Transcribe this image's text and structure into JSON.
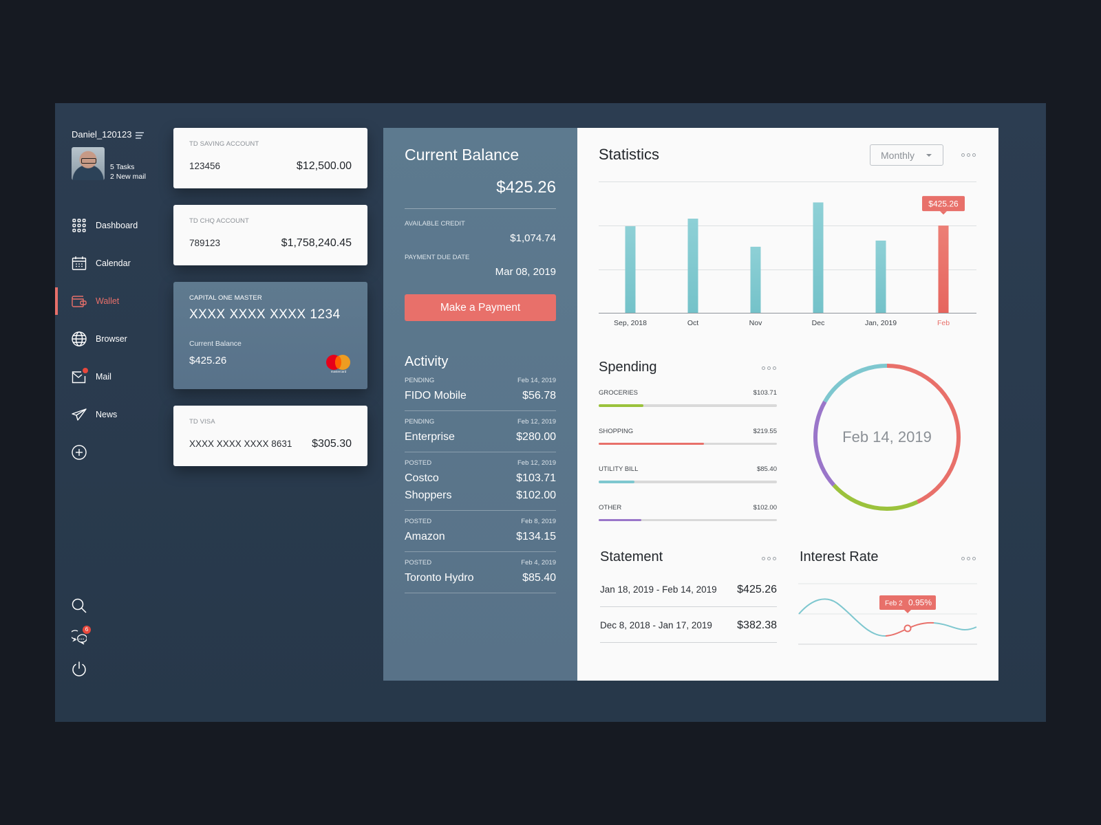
{
  "user": {
    "name": "Daniel_120123",
    "tasks": "5 Tasks",
    "mail": "2 New mail"
  },
  "nav": [
    {
      "label": "Dashboard",
      "icon": "grid-icon",
      "active": false
    },
    {
      "label": "Calendar",
      "icon": "calendar-icon",
      "active": false
    },
    {
      "label": "Wallet",
      "icon": "wallet-icon",
      "active": true
    },
    {
      "label": "Browser",
      "icon": "globe-icon",
      "active": false
    },
    {
      "label": "Mail",
      "icon": "mail-icon",
      "active": false,
      "badge": true
    },
    {
      "label": "News",
      "icon": "paper-plane-icon",
      "active": false
    }
  ],
  "bottom_icons": {
    "chat_badge": "6"
  },
  "accounts": [
    {
      "title": "TD SAVING ACCOUNT",
      "number": "123456",
      "balance": "$12,500.00"
    },
    {
      "title": "TD CHQ ACCOUNT",
      "number": "789123",
      "balance": "$1,758,240.45"
    },
    {
      "title": "CAPITAL ONE MASTER",
      "number": "XXXX XXXX XXXX 1234",
      "balance_label": "Current Balance",
      "balance": "$425.26",
      "brand": "mastercard"
    },
    {
      "title": "TD VISA",
      "number": "XXXX XXXX XXXX 8631",
      "balance": "$305.30"
    }
  ],
  "balance_panel": {
    "title": "Current Balance",
    "amount": "$425.26",
    "available_credit_label": "AVAILABLE CREDIT",
    "available_credit": "$1,074.74",
    "due_label": "PAYMENT DUE DATE",
    "due_date": "Mar 08, 2019",
    "pay_button": "Make a Payment",
    "activity_title": "Activity",
    "activity": [
      {
        "status": "PENDING",
        "date": "Feb 14, 2019",
        "items": [
          {
            "name": "FIDO Mobile",
            "amount": "$56.78"
          }
        ]
      },
      {
        "status": "PENDING",
        "date": "Feb 12, 2019",
        "items": [
          {
            "name": "Enterprise",
            "amount": "$280.00"
          }
        ]
      },
      {
        "status": "POSTED",
        "date": "Feb 12, 2019",
        "items": [
          {
            "name": "Costco",
            "amount": "$103.71"
          },
          {
            "name": "Shoppers",
            "amount": "$102.00"
          }
        ]
      },
      {
        "status": "POSTED",
        "date": "Feb 8, 2019",
        "items": [
          {
            "name": "Amazon",
            "amount": "$134.15"
          }
        ]
      },
      {
        "status": "POSTED",
        "date": "Feb 4, 2019",
        "items": [
          {
            "name": "Toronto Hydro",
            "amount": "$85.40"
          }
        ]
      }
    ]
  },
  "statistics": {
    "title": "Statistics",
    "period": "Monthly"
  },
  "colors": {
    "accent": "#e8706a",
    "teal": "#7ec7cf",
    "green": "#9bc23c",
    "purple": "#9a76c9"
  },
  "chart_data": {
    "type": "bar",
    "title": "Statistics",
    "categories": [
      "Sep, 2018",
      "Oct",
      "Nov",
      "Dec",
      "Jan, 2019",
      "Feb"
    ],
    "values": [
      422,
      459,
      322,
      538,
      352,
      425.26
    ],
    "highlight_index": 5,
    "highlight_label": "$425.26",
    "ylim": [
      0,
      640
    ],
    "grid": true,
    "xlabel": "",
    "ylabel": ""
  },
  "spending": {
    "title": "Spending",
    "items": [
      {
        "label": "GROCERIES",
        "amount": "$103.71",
        "value": 103.71,
        "progress": 0.25,
        "color": "#9bc23c"
      },
      {
        "label": "SHOPPING",
        "amount": "$219.55",
        "value": 219.55,
        "progress": 0.59,
        "color": "#e8706a"
      },
      {
        "label": "UTILITY BILL",
        "amount": "$85.40",
        "value": 85.4,
        "progress": 0.2,
        "color": "#7ec7cf"
      },
      {
        "label": "OTHER",
        "amount": "$102.00",
        "value": 102.0,
        "progress": 0.24,
        "color": "#9a76c9"
      }
    ],
    "donut_center": "Feb 14, 2019",
    "donut_order": [
      "SHOPPING",
      "GROCERIES",
      "OTHER",
      "UTILITY BILL"
    ]
  },
  "statement": {
    "title": "Statement",
    "rows": [
      {
        "range": "Jan 18, 2019 - Feb 14, 2019",
        "amount": "$425.26"
      },
      {
        "range": "Dec 8, 2018 - Jan 17, 2019",
        "amount": "$382.38"
      }
    ]
  },
  "interest": {
    "title": "Interest Rate",
    "tooltip_date": "Feb 2",
    "tooltip_value": "0.95%"
  }
}
